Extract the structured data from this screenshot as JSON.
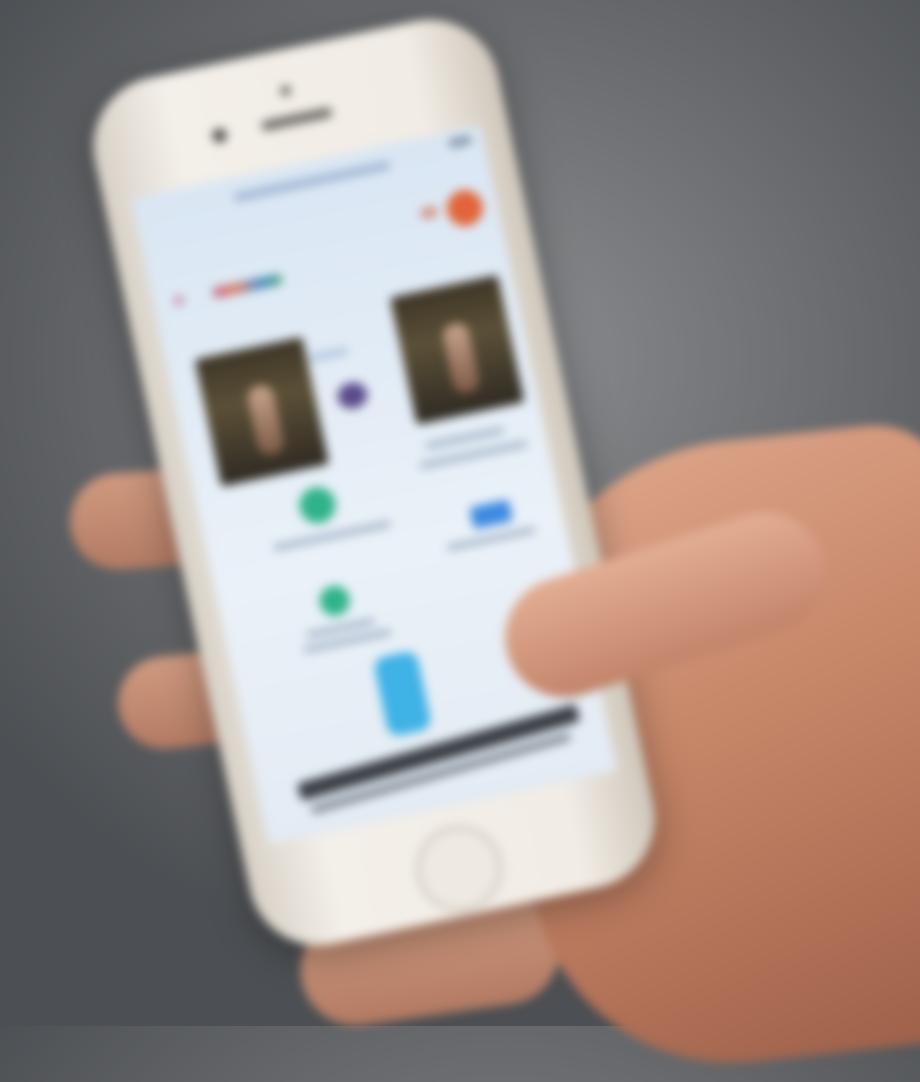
{
  "scene": {
    "description_visible_text": "",
    "colors": {
      "background": "#6e7073",
      "phone_body": "#f1ece5",
      "screen": "#e3ebf4",
      "accent_orange": "#e2643a",
      "accent_green": "#2fb38a",
      "accent_blue": "#3d8ae0",
      "accent_cyan": "#3fb2e6",
      "skin": "#c68668"
    }
  }
}
